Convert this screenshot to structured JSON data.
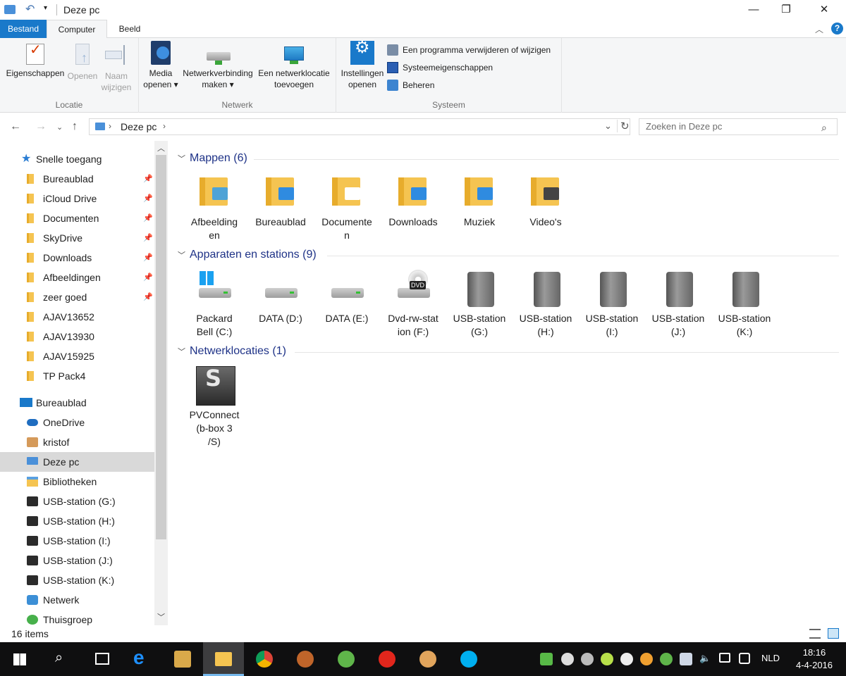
{
  "window": {
    "title": "Deze pc",
    "minimize": "—",
    "maximize": "❐",
    "close": "✕"
  },
  "ribbon_tabs": [
    "Bestand",
    "Computer",
    "Beeld"
  ],
  "ribbon": {
    "groups": {
      "locatie": "Locatie",
      "netwerk": "Netwerk",
      "systeem": "Systeem"
    },
    "eigenschappen": "Eigenschappen",
    "openen": "Openen",
    "naam_wijzigen_1": "Naam",
    "naam_wijzigen_2": "wijzigen",
    "media_openen_1": "Media",
    "media_openen_2": "openen ▾",
    "netwerkverbinding_1": "Netwerkverbinding",
    "netwerkverbinding_2": "maken ▾",
    "netwerklocatie_1": "Een netwerklocatie",
    "netwerklocatie_2": "toevoegen",
    "instellingen_1": "Instellingen",
    "instellingen_2": "openen",
    "programma_verwijderen": "Een programma verwijderen of wijzigen",
    "systeemeigenschappen": "Systeemeigenschappen",
    "beheren": "Beheren",
    "help": "?"
  },
  "address": {
    "path": "Deze pc",
    "search_placeholder": "Zoeken in Deze pc"
  },
  "nav": {
    "quick_access": "Snelle toegang",
    "pinned": [
      "Bureaublad",
      "iCloud Drive",
      "Documenten",
      "SkyDrive",
      "Downloads",
      "Afbeeldingen",
      "zeer goed"
    ],
    "recent": [
      "AJAV13652",
      "AJAV13930",
      "AJAV15925",
      "TP Pack4"
    ],
    "root": [
      "Bureaublad",
      "OneDrive",
      "kristof",
      "Deze pc",
      "Bibliotheken",
      "USB-station (G:)",
      "USB-station (H:)",
      "USB-station (I:)",
      "USB-station (J:)",
      "USB-station (K:)",
      "Netwerk",
      "Thuisgroep"
    ]
  },
  "sections": {
    "folders": {
      "title": "Mappen (6)",
      "items": [
        [
          "Afbeelding",
          "en"
        ],
        [
          "Bureaublad",
          ""
        ],
        [
          "Documente",
          "n"
        ],
        [
          "Downloads",
          ""
        ],
        [
          "Muziek",
          ""
        ],
        [
          "Video's",
          ""
        ]
      ]
    },
    "devices": {
      "title": "Apparaten en stations (9)",
      "items": [
        [
          "Packard",
          "Bell (C:)"
        ],
        [
          "DATA (D:)",
          ""
        ],
        [
          "DATA (E:)",
          ""
        ],
        [
          "Dvd-rw-stat",
          "ion (F:)"
        ],
        [
          "USB-station",
          "(G:)"
        ],
        [
          "USB-station",
          "(H:)"
        ],
        [
          "USB-station",
          "(I:)"
        ],
        [
          "USB-station",
          "(J:)"
        ],
        [
          "USB-station",
          "(K:)"
        ]
      ]
    },
    "network": {
      "title": "Netwerklocaties (1)",
      "items": [
        [
          "PVConnect",
          "(b-box 3",
          "/S)"
        ]
      ]
    }
  },
  "dvd_badge": "DVD",
  "status": {
    "count": "16 items"
  },
  "taskbar": {
    "lang": "NLD",
    "time": "18:16",
    "date": "4-4-2016"
  }
}
